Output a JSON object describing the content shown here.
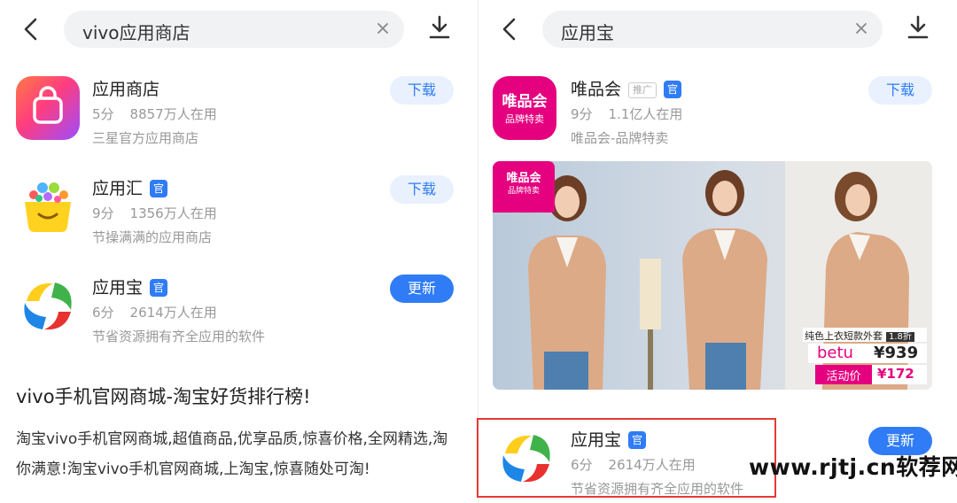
{
  "left": {
    "search": {
      "query": "vivo应用商店"
    },
    "apps": [
      {
        "name": "应用商店",
        "official": false,
        "rating": "5分",
        "users": "8857万人在用",
        "desc": "三星官方应用商店",
        "action": "下载",
        "icon": "samsung-galaxy-store-icon"
      },
      {
        "name": "应用汇",
        "official": true,
        "official_badge": "官",
        "rating": "9分",
        "users": "1356万人在用",
        "desc": "节操满满的应用商店",
        "action": "下载",
        "icon": "yingyonghui-icon"
      },
      {
        "name": "应用宝",
        "official": true,
        "official_badge": "官",
        "rating": "6分",
        "users": "2614万人在用",
        "desc": "节省资源拥有齐全应用的软件",
        "action": "更新",
        "icon": "yingyongbao-icon"
      }
    ],
    "article": {
      "title": "vivo手机官网商城-淘宝好货排行榜!",
      "body": "淘宝vivo手机官网商城,超值商品,优享品质,惊喜价格,全网精选,淘你满意!淘宝vivo手机官网商城,上淘宝,惊喜随处可淘!"
    }
  },
  "right": {
    "search": {
      "query": "应用宝"
    },
    "sponsored": {
      "name": "唯品会",
      "ad_tag": "推广",
      "official_badge": "官",
      "rating": "9分",
      "users": "1.1亿人在用",
      "desc": "唯品会-品牌特卖",
      "action": "下载",
      "icon_text_1": "唯品会",
      "icon_text_2": "品牌特卖"
    },
    "banner": {
      "logo_text_1": "唯品会",
      "logo_text_2": "品牌特卖",
      "product": "纯色上衣短款外套",
      "discount": "1.8折",
      "brand": "betu",
      "price": "¥939",
      "promo_label": "活动价",
      "promo_price": "¥172"
    },
    "app": {
      "name": "应用宝",
      "official_badge": "官",
      "rating": "6分",
      "users": "2614万人在用",
      "desc": "节省资源拥有齐全应用的软件",
      "action": "更新"
    }
  },
  "watermark": "www.rjtj.cn软荐网",
  "colors": {
    "accent": "#2f7cf6",
    "download_bg": "#e8f1fd",
    "highlight": "#e53935",
    "vip_pink": "#e4007f"
  }
}
